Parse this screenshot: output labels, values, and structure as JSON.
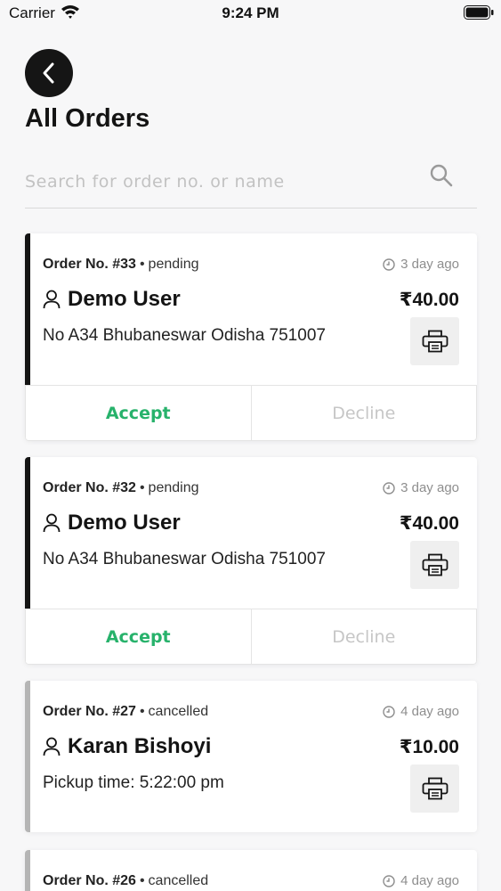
{
  "status_bar": {
    "carrier": "Carrier",
    "time": "9:24 PM"
  },
  "header": {
    "title": "All Orders"
  },
  "search": {
    "placeholder": "Search for order no. or name"
  },
  "orders": [
    {
      "number": "Order No. #33",
      "status": "pending",
      "time": "3 day ago",
      "customer": "Demo User",
      "price": "₹40.00",
      "detail": "No A34 Bhubaneswar Odisha 751007",
      "accept": "Accept",
      "decline": "Decline"
    },
    {
      "number": "Order No. #32",
      "status": "pending",
      "time": "3 day ago",
      "customer": "Demo User",
      "price": "₹40.00",
      "detail": "No A34 Bhubaneswar Odisha 751007",
      "accept": "Accept",
      "decline": "Decline"
    },
    {
      "number": "Order No. #27",
      "status": "cancelled",
      "time": "4 day ago",
      "customer": "Karan Bishoyi",
      "price": "₹10.00",
      "detail": "Pickup time: 5:22:00 pm"
    },
    {
      "number": "Order No. #26",
      "status": "cancelled",
      "time": "4 day ago"
    }
  ],
  "colors": {
    "accept": "#27b26b",
    "decline": "#c6c6c6",
    "pending_accent": "#141414",
    "cancelled_accent": "#b5b5b5"
  },
  "icons": {
    "back": "chevron-left-icon",
    "search": "search-icon",
    "clock": "clock-icon",
    "user": "user-icon",
    "print": "printer-icon"
  }
}
